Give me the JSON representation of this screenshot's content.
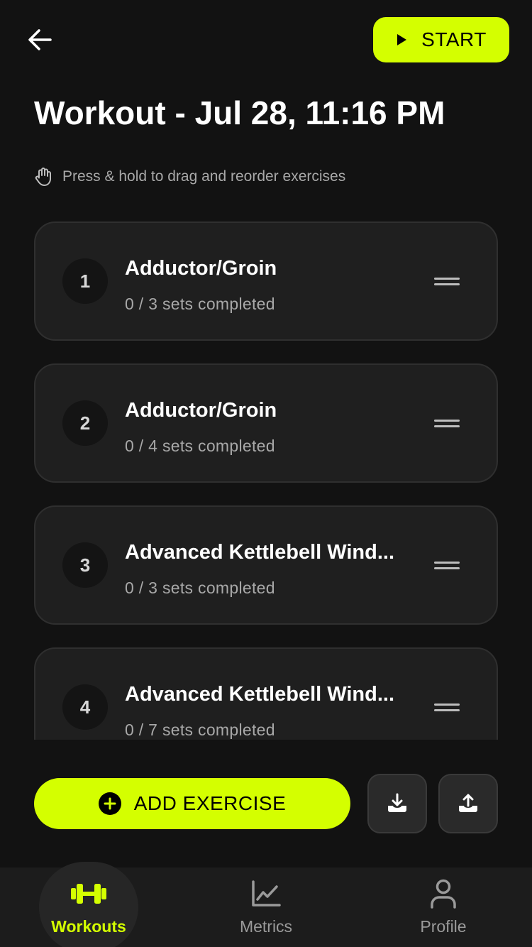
{
  "header": {
    "back_icon": "arrow-left-icon",
    "start_label": "START",
    "start_icon": "play-icon"
  },
  "title": "Workout - Jul 28, 11:16 PM",
  "hint": {
    "icon": "hand-icon",
    "text": "Press & hold to drag and reorder exercises"
  },
  "exercises": [
    {
      "number": "1",
      "name": "Adductor/Groin",
      "sets": "0 / 3 sets completed"
    },
    {
      "number": "2",
      "name": "Adductor/Groin",
      "sets": "0 / 4 sets completed"
    },
    {
      "number": "3",
      "name": "Advanced Kettlebell Wind...",
      "sets": "0 / 3 sets completed"
    },
    {
      "number": "4",
      "name": "Advanced Kettlebell Wind...",
      "sets": "0 / 7 sets completed"
    }
  ],
  "actions": {
    "add_label": "ADD EXERCISE",
    "add_icon": "plus-circle-icon",
    "import_icon": "download-icon",
    "export_icon": "upload-icon"
  },
  "nav": {
    "items": [
      {
        "label": "Workouts",
        "icon": "dumbbell-icon",
        "active": true
      },
      {
        "label": "Metrics",
        "icon": "chart-line-icon",
        "active": false
      },
      {
        "label": "Profile",
        "icon": "person-icon",
        "active": false
      }
    ]
  },
  "colors": {
    "accent": "#d4ff00",
    "background": "#121212",
    "card": "#1f1f1f",
    "muted_text": "#a8a8a8"
  }
}
